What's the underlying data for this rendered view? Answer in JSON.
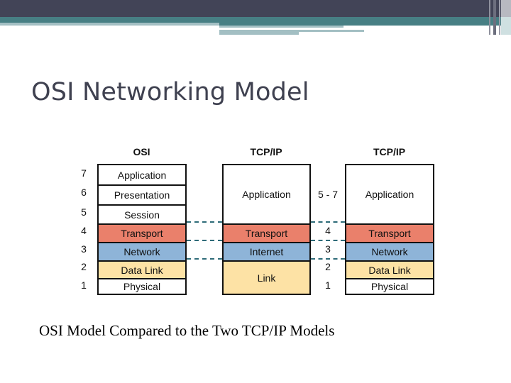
{
  "slide": {
    "title": "OSI Networking Model",
    "caption": "OSI Model Compared to the Two TCP/IP Models"
  },
  "colors": {
    "header_dark": "#424457",
    "header_teal": "#477f84",
    "transport": "#ea806b",
    "network": "#8eb4d8",
    "data_link": "#fde2a5",
    "plain": "#ffffff",
    "dash": "#2e6b78"
  },
  "diagram": {
    "osi": {
      "heading": "OSI",
      "numbers": [
        "7",
        "6",
        "5",
        "4",
        "3",
        "2",
        "1"
      ],
      "layers": [
        "Application",
        "Presentation",
        "Session",
        "Transport",
        "Network",
        "Data Link",
        "Physical"
      ]
    },
    "tcpip_4layer": {
      "heading": "TCP/IP",
      "layers": [
        "Application",
        "Transport",
        "Internet",
        "Link"
      ]
    },
    "middle_numbers": [
      "5 - 7",
      "4",
      "3",
      "2",
      "1"
    ],
    "tcpip_5layer": {
      "heading": "TCP/IP",
      "layers": [
        "Application",
        "Transport",
        "Network",
        "Data Link",
        "Physical"
      ]
    }
  }
}
